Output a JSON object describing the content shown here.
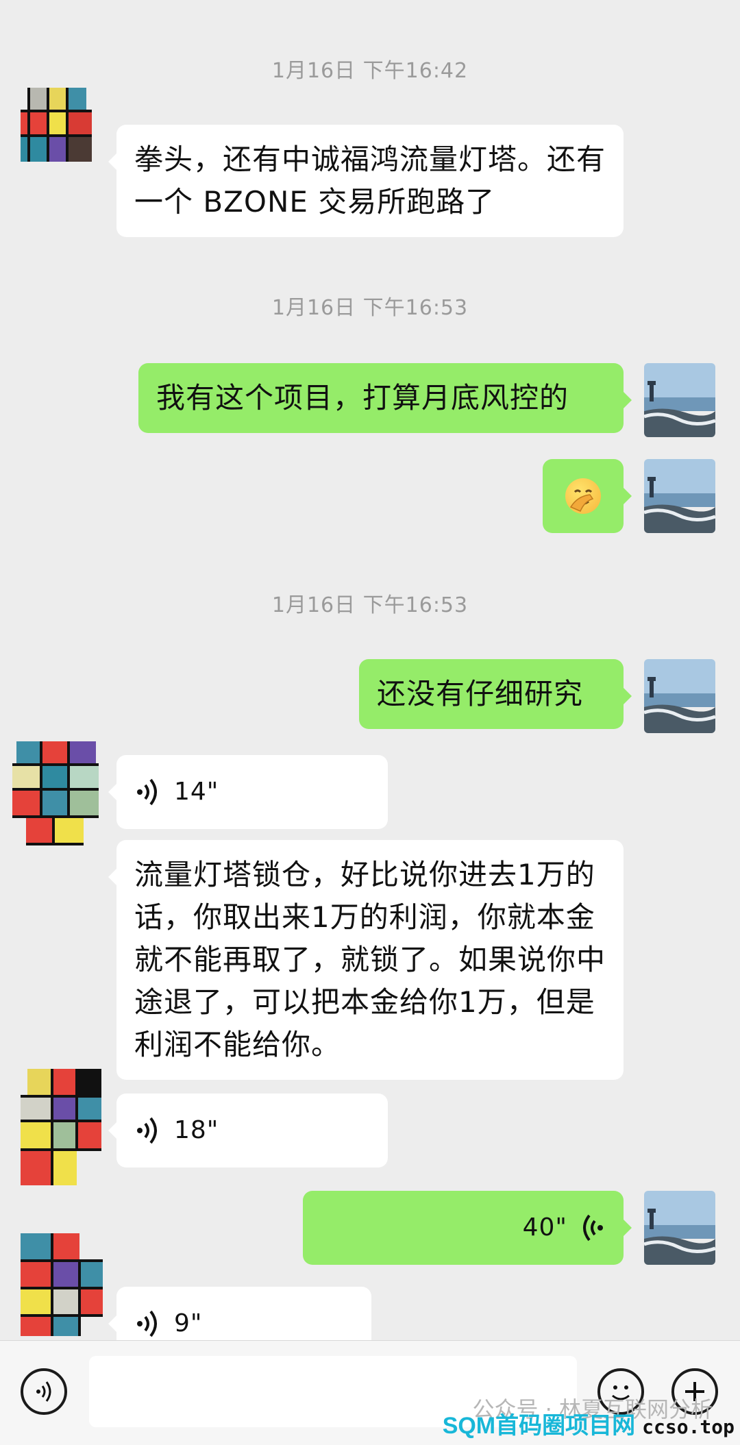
{
  "timestamps": [
    "1月16日 下午16:42",
    "1月16日 下午16:53",
    "1月16日 下午16:53"
  ],
  "messages": {
    "m1": "拳头，还有中诚福鸿流量灯塔。还有一个 BZONE 交易所跑路了",
    "m2": "我有这个项目，打算月底风控的",
    "m4": "还没有仔细研究",
    "m5_duration": "14\"",
    "m6": "流量灯塔锁仓，好比说你进去1万的话，你取出来1万的利润，你就本金就不能再取了，就锁了。如果说你中途退了，可以把本金给你1万，但是利润不能给你。",
    "m7_duration": "18\"",
    "m8_duration": "40\"",
    "m9_duration": "9\""
  },
  "watermark": {
    "text": "公众号 · 林夏互联网分析",
    "site_brand": "SQM首码圈项目网",
    "site_url": "ccso.top"
  },
  "icons": {
    "emoji": "facepalm-emoji",
    "voice_input": "voice-input-icon",
    "emoji_button": "smiley-icon",
    "plus_button": "plus-icon"
  },
  "colors": {
    "background": "#ededed",
    "outgoing_bubble": "#95ec69",
    "incoming_bubble": "#ffffff",
    "timestamp": "#9a9a9a"
  }
}
